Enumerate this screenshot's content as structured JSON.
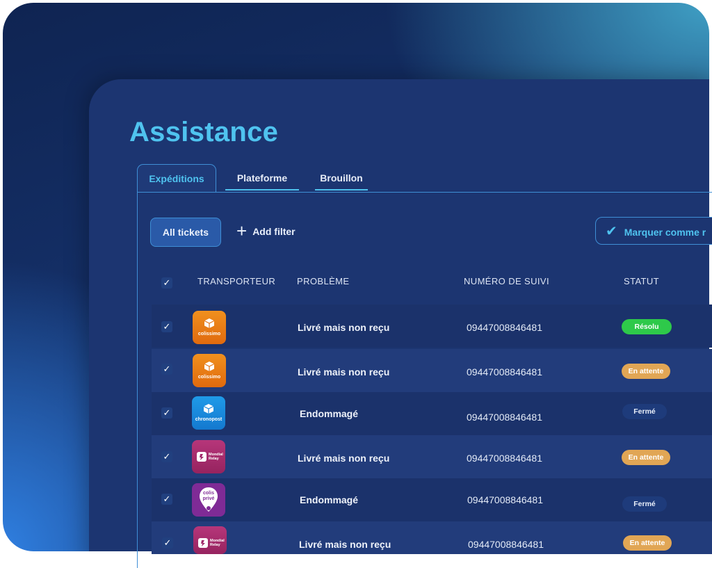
{
  "page": {
    "title": "Assistance"
  },
  "tabs": [
    {
      "label": "Expéditions",
      "active": true
    },
    {
      "label": "Plateforme",
      "active": false
    },
    {
      "label": "Brouillon",
      "active": false
    }
  ],
  "toolbar": {
    "all_tickets": "All tickets",
    "add_filter": "Add filter",
    "mark_as": "Marquer comme r"
  },
  "table": {
    "columns": [
      "TRANSPORTEUR",
      "PROBLÈME",
      "NUMÉRO DE SUIVI",
      "STATUT"
    ],
    "rows": [
      {
        "carrier": "colissimo",
        "carrier_icon": "colissimo-logo",
        "problem": "Livré mais non reçu",
        "tracking": "09447008846481",
        "status": "Résolu",
        "status_color": "#2ec94a"
      },
      {
        "carrier": "colissimo",
        "carrier_icon": "colissimo-logo",
        "problem": "Livré mais non reçu",
        "tracking": "09447008846481",
        "status": "En attente",
        "status_color": "#e1a655"
      },
      {
        "carrier": "chronopost",
        "carrier_icon": "chronopost-logo",
        "problem": "Endommagé",
        "tracking": "09447008846481",
        "status": "Fermé",
        "status_color": "#1e3b7b"
      },
      {
        "carrier": "Mondial Relay",
        "carrier_icon": "mondial-relay-logo",
        "problem": "Livré mais non reçu",
        "tracking": "09447008846481",
        "status": "En attente",
        "status_color": "#e1a655"
      },
      {
        "carrier": "colis privé",
        "carrier_icon": "colis-prive-logo",
        "problem": "Endommagé",
        "tracking": "09447008846481",
        "status": "Fermé",
        "status_color": "#1e3b7b"
      },
      {
        "carrier": "Mondial Relay",
        "carrier_icon": "mondial-relay-logo",
        "problem": "Livré mais non reçu",
        "tracking": "09447008846481",
        "status": "En attente",
        "status_color": "#e1a655"
      }
    ]
  },
  "colors": {
    "accent": "#4fc3ef",
    "panel": "#1c3571",
    "success": "#2ec94a",
    "pending": "#e1a655"
  }
}
